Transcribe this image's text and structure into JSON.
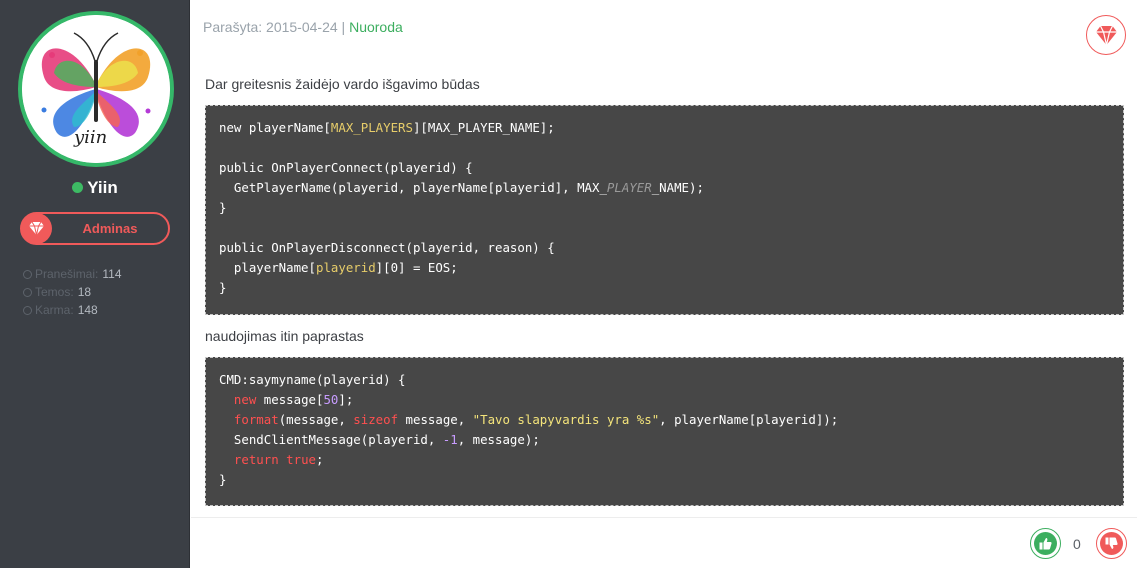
{
  "user": {
    "username": "Yiin",
    "avatar_text": "yiin",
    "online_color": "#3dbb64",
    "role": "Adminas",
    "role_color": "#f05a5a",
    "stats": [
      {
        "label": "Pranešimai:",
        "value": "114"
      },
      {
        "label": "Temos:",
        "value": "18"
      },
      {
        "label": "Karma:",
        "value": "148"
      }
    ]
  },
  "post": {
    "meta_prefix": "Parašyta:",
    "date": "2015-04-24",
    "separator": "|",
    "link_label": "Nuoroda",
    "badge_icon": "diamond-icon",
    "paragraph1": "Dar greitesnis žaidėjo vardo išgavimo būdas",
    "paragraph2": "naudojimas itin paprastas",
    "code1": [
      [
        [
          "new playerName[",
          ""
        ],
        [
          "MAX_PLAYERS",
          "hl"
        ],
        [
          "][MAX_PLAYER_NAME];",
          ""
        ]
      ],
      [],
      [
        [
          "public OnPlayerConnect(playerid) {",
          ""
        ]
      ],
      [
        [
          "  GetPlayerName(playerid, playerName[playerid], MAX_",
          ""
        ],
        [
          "PLAYER",
          "it"
        ],
        [
          "_NAME);",
          ""
        ]
      ],
      [
        [
          "}",
          ""
        ]
      ],
      [],
      [
        [
          "public OnPlayerDisconnect(playerid, reason) {",
          ""
        ]
      ],
      [
        [
          "  playerName[",
          ""
        ],
        [
          "playerid",
          "hl"
        ],
        [
          "][0] = EOS;",
          ""
        ]
      ],
      [
        [
          "}",
          ""
        ]
      ]
    ],
    "code2": [
      [
        [
          "CMD:saymyname(playerid) {",
          ""
        ]
      ],
      [
        [
          "  ",
          ""
        ],
        [
          "new",
          "kw"
        ],
        [
          " message[",
          ""
        ],
        [
          "50",
          "num"
        ],
        [
          "];",
          ""
        ]
      ],
      [
        [
          "  ",
          ""
        ],
        [
          "format",
          "kw"
        ],
        [
          "(message, ",
          ""
        ],
        [
          "sizeof",
          "kw"
        ],
        [
          " message, ",
          ""
        ],
        [
          "\"Tavo slapyvardis yra %s\"",
          "str"
        ],
        [
          ", playerName[playerid]);",
          ""
        ]
      ],
      [
        [
          "  SendClientMessage(playerid, ",
          ""
        ],
        [
          "-1",
          "num"
        ],
        [
          ", message);",
          ""
        ]
      ],
      [
        [
          "  ",
          ""
        ],
        [
          "return",
          "kw"
        ],
        [
          " ",
          ""
        ],
        [
          "true",
          "kw"
        ],
        [
          ";",
          ""
        ]
      ],
      [
        [
          "}",
          ""
        ]
      ]
    ]
  },
  "votes": {
    "count": "0",
    "up_icon": "thumbs-up-icon",
    "down_icon": "thumbs-down-icon",
    "up_color": "#3cae5f",
    "down_color": "#f05a5a"
  }
}
